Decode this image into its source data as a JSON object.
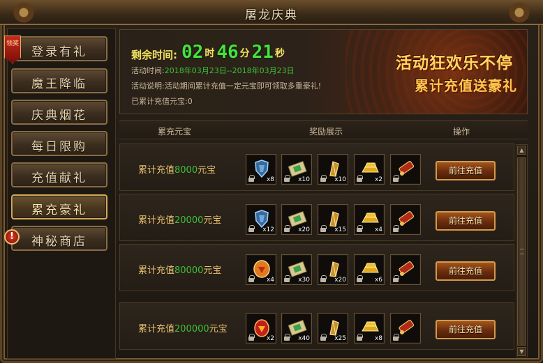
{
  "window": {
    "title": "屠龙庆典"
  },
  "sidebar": {
    "items": [
      {
        "label": "登录有礼",
        "badge": "领奖"
      },
      {
        "label": "魔王降临"
      },
      {
        "label": "庆典烟花"
      },
      {
        "label": "每日限购"
      },
      {
        "label": "充值献礼"
      },
      {
        "label": "累充豪礼",
        "active": true
      },
      {
        "label": "神秘商店",
        "badge": "!"
      }
    ]
  },
  "banner": {
    "timer_label": "剩余时间:",
    "hours": "02",
    "hours_unit": "时",
    "minutes": "46",
    "minutes_unit": "分",
    "seconds": "21",
    "seconds_unit": "秒",
    "time_label": "活动时间:",
    "time_value": "2018年03月23日--2018年03月23日",
    "desc_label": "活动说明:",
    "desc_value": "活动期间累计充值一定元宝即可领取多重豪礼!",
    "total_label": "已累计充值元宝:",
    "total_value": "0",
    "slogan_1": "活动狂欢乐不停",
    "slogan_2": "累计充值送豪礼"
  },
  "table": {
    "col_amount": "累充元宝",
    "col_rewards": "奖励展示",
    "col_action": "操作"
  },
  "rows": [
    {
      "prefix": "累计充值",
      "amount": "8000",
      "suffix": "元宝",
      "button": "前往充值",
      "items": [
        {
          "icon": "blue-armor-icon",
          "qty": "x8"
        },
        {
          "icon": "green-scroll-icon",
          "qty": "x10"
        },
        {
          "icon": "gold-crystal-icon",
          "qty": "x10"
        },
        {
          "icon": "gold-ingot-icon",
          "qty": "x2"
        },
        {
          "icon": "red-scroll-icon",
          "qty": ""
        }
      ]
    },
    {
      "prefix": "累计充值",
      "amount": "20000",
      "suffix": "元宝",
      "button": "前往充值",
      "items": [
        {
          "icon": "blue-armor-icon",
          "qty": "x12"
        },
        {
          "icon": "green-scroll-icon",
          "qty": "x20"
        },
        {
          "icon": "gold-crystal-icon",
          "qty": "x15"
        },
        {
          "icon": "gold-ingot-icon",
          "qty": "x4"
        },
        {
          "icon": "red-scroll-icon",
          "qty": ""
        }
      ]
    },
    {
      "prefix": "累计充值",
      "amount": "80000",
      "suffix": "元宝",
      "button": "前往充值",
      "items": [
        {
          "icon": "orange-gem-icon",
          "qty": "x4"
        },
        {
          "icon": "green-scroll-icon",
          "qty": "x30"
        },
        {
          "icon": "gold-crystal-icon",
          "qty": "x20"
        },
        {
          "icon": "gold-ingot-icon",
          "qty": "x6"
        },
        {
          "icon": "red-scroll-icon",
          "qty": ""
        }
      ]
    },
    {
      "prefix": "累计充值",
      "amount": "200000",
      "suffix": "元宝",
      "button": "前往充值",
      "items": [
        {
          "icon": "red-gem-icon",
          "qty": "x2"
        },
        {
          "icon": "green-scroll-icon",
          "qty": "x40"
        },
        {
          "icon": "gold-crystal-icon",
          "qty": "x25"
        },
        {
          "icon": "gold-ingot-icon",
          "qty": "x8"
        },
        {
          "icon": "red-scroll-icon",
          "qty": ""
        }
      ]
    }
  ],
  "colors": {
    "timer": "#48e040",
    "accent": "#e8c070",
    "amount": "#3ec03a"
  }
}
